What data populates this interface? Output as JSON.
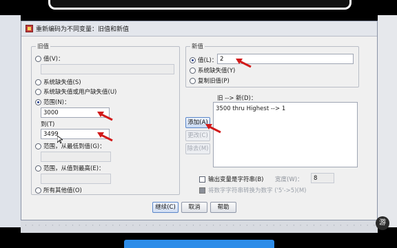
{
  "dialog": {
    "title": "重新编码为不同变量：旧值和新值"
  },
  "old_value": {
    "legend": "旧值",
    "value_label": "值(V)：",
    "system_missing_label": "系统缺失值(S)",
    "system_or_user_missing_label": "系统缺失值或用户缺失值(U)",
    "range_label": "范围(N)：",
    "range_from_value": "3000",
    "range_to_label": "到(T)",
    "range_to_value": "3499",
    "range_lowest_label": "范围，从最低到值(G)：",
    "range_highest_label": "范围，从值到最高(E)：",
    "all_other_label": "所有其他值(O)"
  },
  "new_value": {
    "legend": "新值",
    "value_label": "值(L)：",
    "value": "2",
    "system_missing_label": "系统缺失值(Y)",
    "copy_old_label": "复制旧值(P)"
  },
  "mapping": {
    "label": "旧 --> 新(D)：",
    "items": [
      "3500 thru Highest --> 1"
    ]
  },
  "buttons": {
    "add": "添加(A)",
    "change": "更改(C)",
    "remove": "除去(M)",
    "continue": "继续(C)",
    "cancel": "取消",
    "help": "帮助"
  },
  "options": {
    "output_as_string_label": "输出变量是字符串(B)",
    "width_label": "宽度(W)：",
    "width_value": "8",
    "convert_numeric_label": "将数字字符串转换为数字 ('5'->5)(M)"
  },
  "badge": "游",
  "colors": {
    "arrow_red": "#d11a1a",
    "accent_blue": "#2d8ce8"
  }
}
